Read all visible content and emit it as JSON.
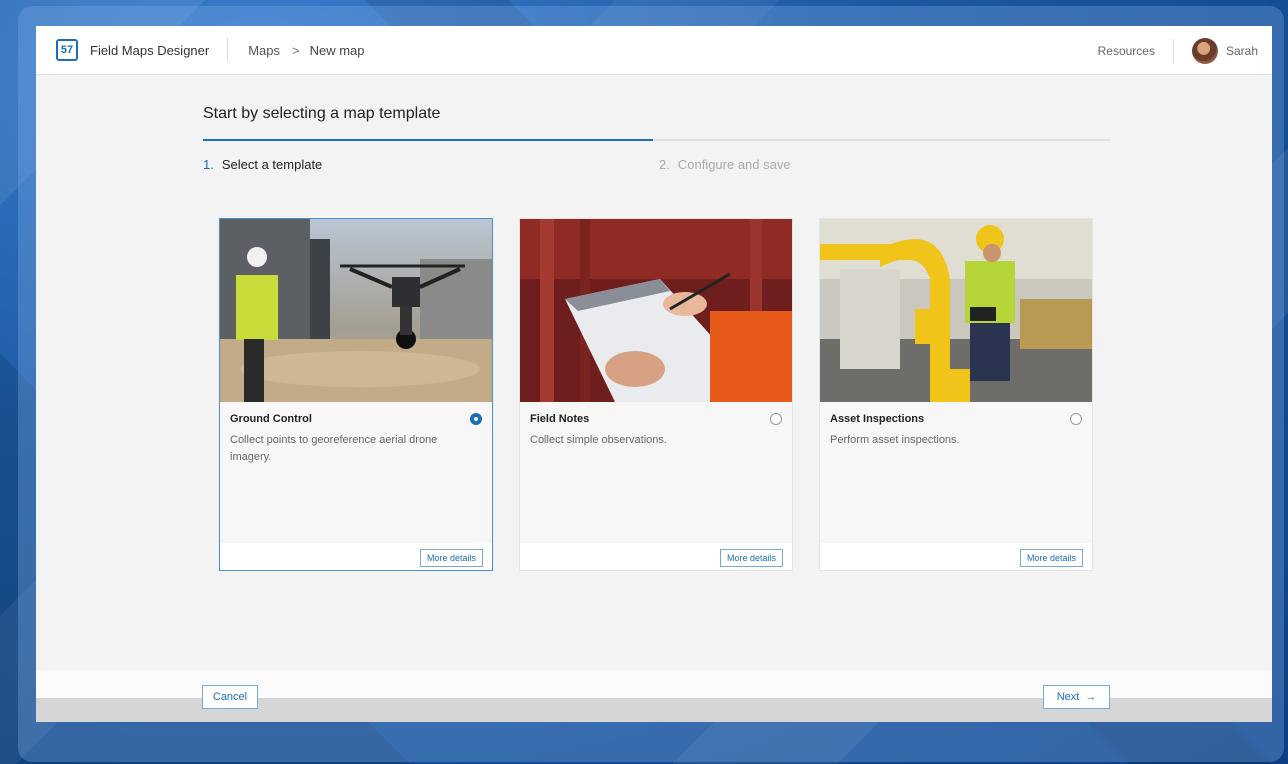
{
  "header": {
    "app_name": "Field Maps Designer",
    "breadcrumb": {
      "root": "Maps",
      "separator": ">",
      "current": "New map"
    },
    "resources_label": "Resources",
    "user_name": "Sarah"
  },
  "main": {
    "title": "Start by selecting a map template",
    "steps": [
      {
        "number": "1.",
        "label": "Select a template",
        "active": true
      },
      {
        "number": "2.",
        "label": "Configure and save",
        "active": false
      }
    ],
    "progress_fraction": 0.5,
    "templates": [
      {
        "title": "Ground Control",
        "description": "Collect points to georeference aerial drone imagery.",
        "more_label": "More details",
        "selected": true,
        "image": "drone-photo"
      },
      {
        "title": "Field Notes",
        "description": "Collect simple observations.",
        "more_label": "More details",
        "selected": false,
        "image": "clipboard-photo"
      },
      {
        "title": "Asset Inspections",
        "description": "Perform asset inspections.",
        "more_label": "More details",
        "selected": false,
        "image": "pipeline-worker-photo"
      }
    ]
  },
  "footer": {
    "cancel_label": "Cancel",
    "next_label": "Next",
    "next_icon": "→"
  },
  "colors": {
    "accent": "#1a6fb8"
  }
}
